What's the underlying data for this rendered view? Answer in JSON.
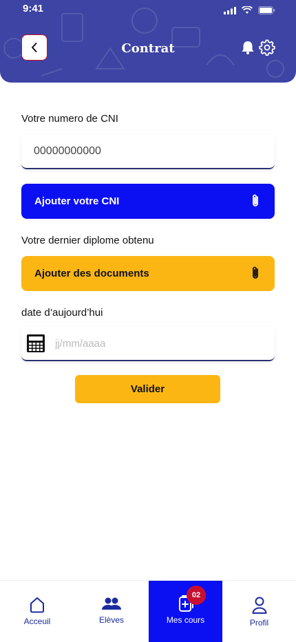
{
  "status_bar": {
    "time": "9:41"
  },
  "header": {
    "title": "Contrat",
    "background_color": "#3d44a3",
    "icons": [
      "back-icon",
      "bell-icon",
      "gear-icon"
    ]
  },
  "form": {
    "cni_label": "Votre numero de CNI",
    "cni_input_value": "00000000000",
    "cni_button_label": "Ajouter votre CNI",
    "diploma_label": "Votre dernier diplome obtenu",
    "documents_button_label": "Ajouter des documents",
    "date_label": "date d’aujourd’hui",
    "date_placeholder": "jj/mm/aaaa",
    "submit_label": "Valider"
  },
  "colors": {
    "primary_blue": "#0b10f2",
    "accent_yellow": "#fbb614",
    "nav_text": "#1c2b9e",
    "badge_red": "#c8102e"
  },
  "bottom_nav": {
    "items": [
      {
        "label": "Acceuil",
        "icon": "home-icon",
        "active": false
      },
      {
        "label": "Elèves",
        "icon": "users-icon",
        "active": false
      },
      {
        "label": "Mes cours",
        "icon": "courses-icon",
        "active": true,
        "badge": "02"
      },
      {
        "label": "Profil",
        "icon": "profile-icon",
        "active": false
      }
    ]
  }
}
